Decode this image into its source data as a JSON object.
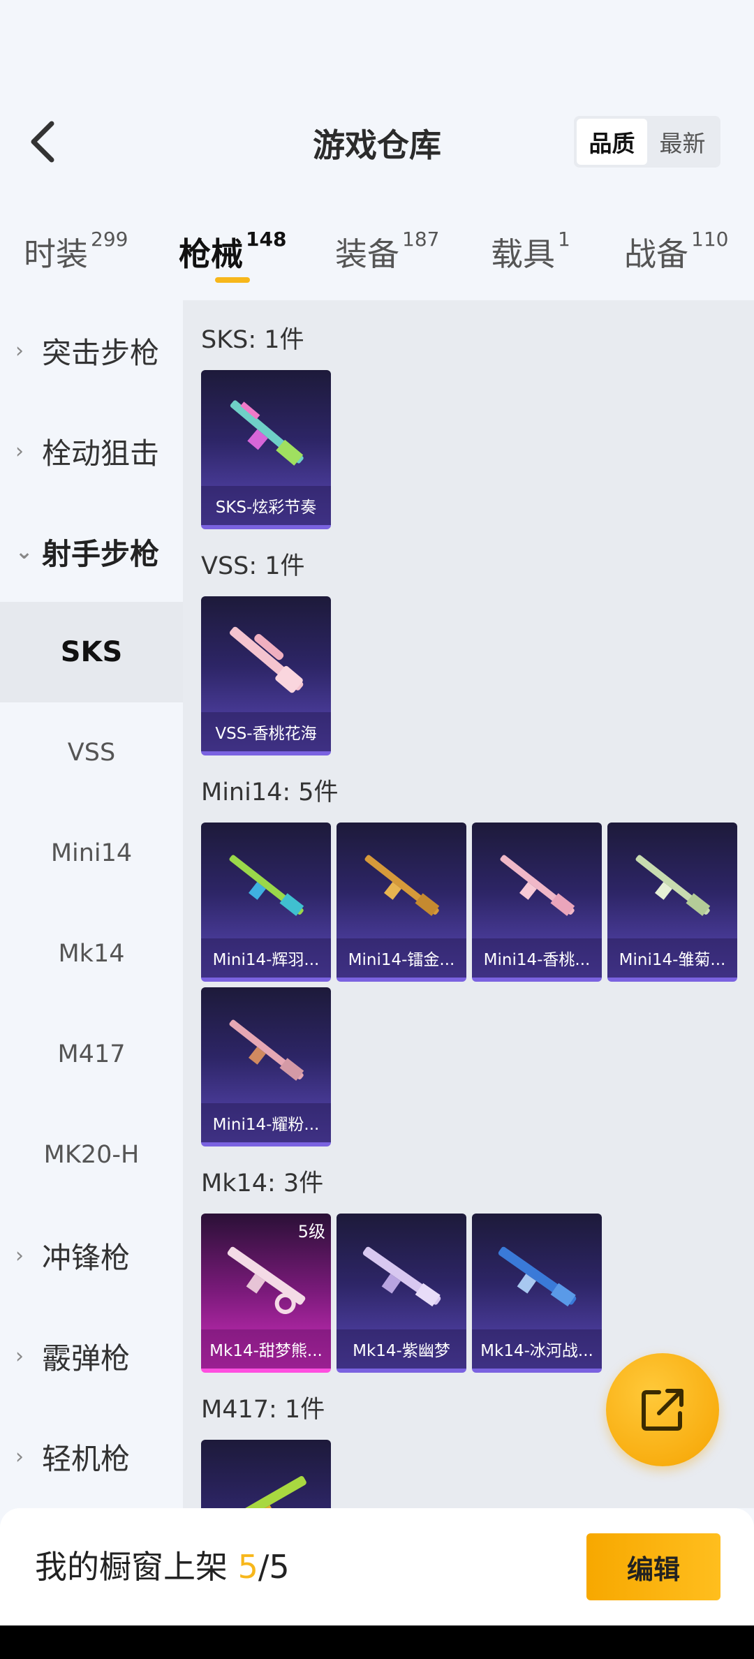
{
  "header": {
    "title": "游戏仓库",
    "sort_options": [
      "品质",
      "最新"
    ]
  },
  "tabs": [
    {
      "label": "时装",
      "count": "299"
    },
    {
      "label": "枪械",
      "count": "148"
    },
    {
      "label": "装备",
      "count": "187"
    },
    {
      "label": "载具",
      "count": "1"
    },
    {
      "label": "战备",
      "count": "110"
    }
  ],
  "sidebar": {
    "categories": [
      "突击步枪",
      "栓动狙击",
      "射手步枪",
      "冲锋枪",
      "霰弹枪",
      "轻机枪"
    ],
    "subitems": [
      "SKS",
      "VSS",
      "Mini14",
      "Mk14",
      "M417",
      "MK20-H"
    ]
  },
  "groups": [
    {
      "title": "SKS: 1件",
      "items": [
        {
          "label": "SKS-炫彩节奏"
        }
      ]
    },
    {
      "title": "VSS: 1件",
      "items": [
        {
          "label": "VSS-香桃花海"
        }
      ]
    },
    {
      "title": "Mini14: 5件",
      "items": [
        {
          "label": "Mini14-辉羽..."
        },
        {
          "label": "Mini14-镭金..."
        },
        {
          "label": "Mini14-香桃..."
        },
        {
          "label": "Mini14-雏菊..."
        },
        {
          "label": "Mini14-耀粉..."
        }
      ]
    },
    {
      "title": "Mk14: 3件",
      "items": [
        {
          "label": "Mk14-甜梦熊...",
          "level": "5级"
        },
        {
          "label": "Mk14-紫幽梦"
        },
        {
          "label": "Mk14-冰河战..."
        }
      ]
    },
    {
      "title": "M417: 1件",
      "items": []
    }
  ],
  "bottom_bar": {
    "showcase_prefix": "我的橱窗上架 ",
    "showcase_current": "5",
    "showcase_total": "/5",
    "edit_label": "编辑"
  },
  "colors": {
    "accent": "#f7b71b",
    "card_purple": "#5b49b8",
    "card_pink": "#d22fbf"
  },
  "icons": {
    "back": "chevron-left-icon",
    "share": "share-external-icon",
    "gun": "rifle-skin-icon"
  }
}
